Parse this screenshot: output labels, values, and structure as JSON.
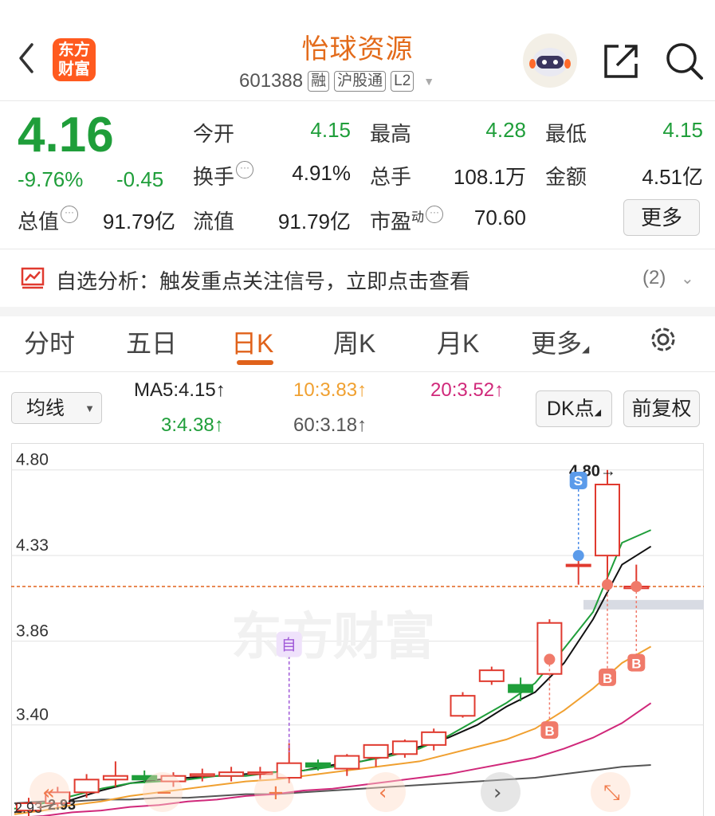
{
  "header": {
    "logo_line1": "东方",
    "logo_line2": "财富",
    "stock_name": "怡球资源",
    "code": "601388",
    "tags": [
      "融",
      "沪股通",
      "L2"
    ]
  },
  "quote": {
    "price": "4.16",
    "change_pct": "-9.76%",
    "change_amt": "-0.45",
    "open_label": "今开",
    "open": "4.15",
    "high_label": "最高",
    "high": "4.28",
    "low_label": "最低",
    "low": "4.15",
    "turnover_label": "换手",
    "turnover": "4.91%",
    "volume_label": "总手",
    "volume": "108.1万",
    "amount_label": "金额",
    "amount": "4.51亿",
    "mktcap_label": "总值",
    "mktcap": "91.79亿",
    "float_label": "流值",
    "float_cap": "91.79亿",
    "pe_label": "市盈",
    "pe_sup": "动",
    "pe": "70.60",
    "more": "更多"
  },
  "analysis": {
    "text": "自选分析：触发重点关注信号，立即点击查看",
    "count": "(2)"
  },
  "tabs": [
    "分时",
    "五日",
    "日K",
    "周K",
    "月K",
    "更多"
  ],
  "active_tab": "日K",
  "ma_bar": {
    "select": "均线",
    "ma5": "MA5:4.15↑",
    "ma10": "10:3.83↑",
    "ma20": "20:3.52↑",
    "ma3": "3:4.38↑",
    "ma60": "60:3.18↑",
    "dk_button": "DK点",
    "fq_button": "前复权"
  },
  "colors": {
    "up": "#e03a2f",
    "down": "#1f9e3a",
    "accent": "#e0621b",
    "ma5": "#1f9e3a",
    "ma10": "#f0a030",
    "ma20": "#d0287a",
    "ma60": "#555555",
    "ma3": "#111111"
  },
  "chart_data": {
    "type": "candlestick",
    "y_ticks": [
      "4.80",
      "4.33",
      "3.86",
      "3.40"
    ],
    "max_annotation": "4.80→",
    "min_annotation": "2.93",
    "left_bottom_label": "2.93",
    "current_price_line": 4.16,
    "watermark": "东方财富",
    "marker_self": "自",
    "marker_sell": "S",
    "marker_buy": "B",
    "candles": [
      {
        "o": 2.93,
        "h": 3.0,
        "l": 2.9,
        "c": 2.97
      },
      {
        "o": 2.97,
        "h": 3.06,
        "l": 2.95,
        "c": 3.03
      },
      {
        "o": 3.03,
        "h": 3.13,
        "l": 3.0,
        "c": 3.1
      },
      {
        "o": 3.1,
        "h": 3.2,
        "l": 3.06,
        "c": 3.12
      },
      {
        "o": 3.12,
        "h": 3.15,
        "l": 3.08,
        "c": 3.1
      },
      {
        "o": 3.09,
        "h": 3.14,
        "l": 3.06,
        "c": 3.12
      },
      {
        "o": 3.12,
        "h": 3.16,
        "l": 3.09,
        "c": 3.13
      },
      {
        "o": 3.12,
        "h": 3.17,
        "l": 3.09,
        "c": 3.14
      },
      {
        "o": 3.13,
        "h": 3.17,
        "l": 3.1,
        "c": 3.14
      },
      {
        "o": 3.11,
        "h": 3.3,
        "l": 3.08,
        "c": 3.19
      },
      {
        "o": 3.19,
        "h": 3.21,
        "l": 3.15,
        "c": 3.17
      },
      {
        "o": 3.16,
        "h": 3.24,
        "l": 3.12,
        "c": 3.23
      },
      {
        "o": 3.22,
        "h": 3.29,
        "l": 3.17,
        "c": 3.29
      },
      {
        "o": 3.24,
        "h": 3.32,
        "l": 3.22,
        "c": 3.31
      },
      {
        "o": 3.29,
        "h": 3.38,
        "l": 3.26,
        "c": 3.36
      },
      {
        "o": 3.45,
        "h": 3.58,
        "l": 3.44,
        "c": 3.56
      },
      {
        "o": 3.64,
        "h": 3.72,
        "l": 3.62,
        "c": 3.7
      },
      {
        "o": 3.62,
        "h": 3.66,
        "l": 3.53,
        "c": 3.58
      },
      {
        "o": 3.68,
        "h": 3.98,
        "l": 3.68,
        "c": 3.96
      },
      {
        "o": 4.28,
        "h": 4.33,
        "l": 4.17,
        "c": 4.28
      },
      {
        "o": 4.33,
        "h": 4.8,
        "l": 4.17,
        "c": 4.72
      },
      {
        "o": 4.15,
        "h": 4.28,
        "l": 4.15,
        "c": 4.16
      }
    ],
    "ma5": [
      2.94,
      2.97,
      3.01,
      3.05,
      3.08,
      3.09,
      3.1,
      3.12,
      3.12,
      3.14,
      3.15,
      3.17,
      3.2,
      3.23,
      3.27,
      3.34,
      3.43,
      3.52,
      3.63,
      3.82,
      4.02,
      4.4,
      4.47
    ],
    "ma10": [
      2.91,
      2.93,
      2.96,
      2.98,
      3.01,
      3.03,
      3.05,
      3.07,
      3.09,
      3.1,
      3.12,
      3.14,
      3.16,
      3.18,
      3.2,
      3.24,
      3.28,
      3.32,
      3.38,
      3.48,
      3.6,
      3.74,
      3.83
    ],
    "ma20": [
      2.89,
      2.9,
      2.92,
      2.93,
      2.95,
      2.96,
      2.98,
      2.99,
      3.01,
      3.02,
      3.04,
      3.05,
      3.07,
      3.09,
      3.11,
      3.13,
      3.16,
      3.19,
      3.22,
      3.27,
      3.33,
      3.41,
      3.52
    ],
    "ma60": [
      2.97,
      2.98,
      2.98,
      2.99,
      2.99,
      3.0,
      3.0,
      3.01,
      3.02,
      3.02,
      3.03,
      3.04,
      3.05,
      3.06,
      3.07,
      3.08,
      3.09,
      3.1,
      3.11,
      3.13,
      3.15,
      3.17,
      3.18
    ],
    "ma3": [
      2.92,
      2.95,
      2.99,
      3.04,
      3.08,
      3.1,
      3.11,
      3.12,
      3.13,
      3.14,
      3.15,
      3.18,
      3.2,
      3.24,
      3.28,
      3.33,
      3.4,
      3.5,
      3.58,
      3.74,
      3.98,
      4.28,
      4.38
    ],
    "ylim": [
      2.9,
      4.86
    ]
  }
}
